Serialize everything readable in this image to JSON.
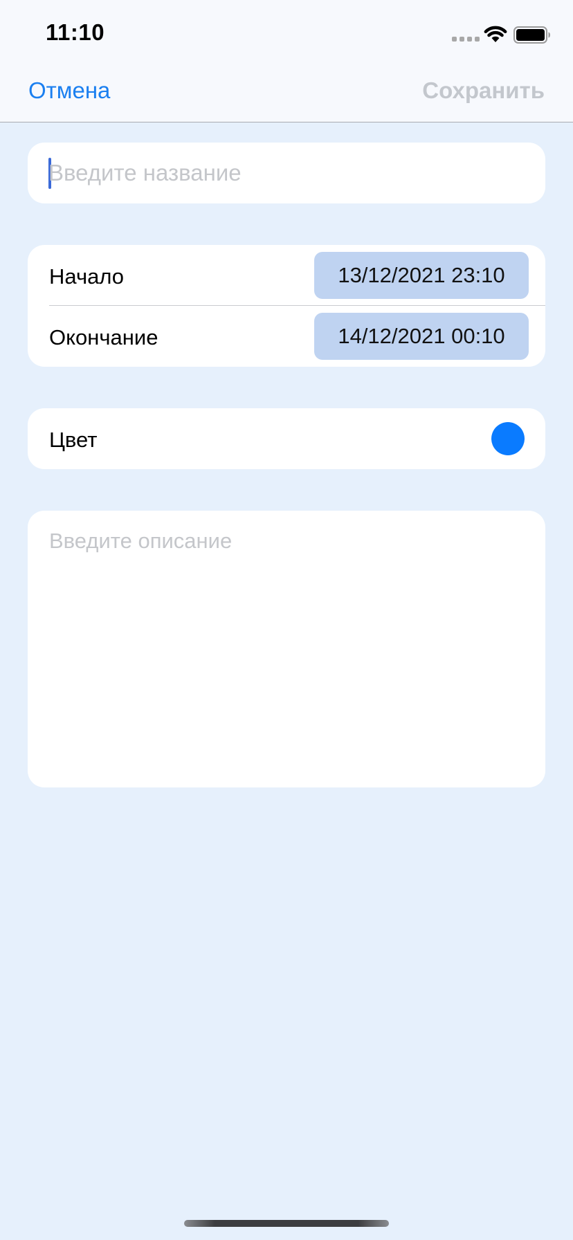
{
  "status_bar": {
    "time": "11:10",
    "icons": [
      "signal-icon",
      "wifi-icon",
      "battery-icon"
    ]
  },
  "nav": {
    "cancel_label": "Отмена",
    "save_label": "Сохранить"
  },
  "title_field": {
    "value": "",
    "placeholder": "Введите название"
  },
  "dates": {
    "start_label": "Начало",
    "start_value": "13/12/2021 23:10",
    "end_label": "Окончание",
    "end_value": "14/12/2021 00:10"
  },
  "color_row": {
    "label": "Цвет",
    "selected_color": "#0a7bff"
  },
  "description_field": {
    "value": "",
    "placeholder": "Введите описание"
  },
  "colors": {
    "accent": "#1a7ff0",
    "disabled": "#c3c7cd",
    "background": "#e6f0fc",
    "date_pill": "#bfd3f1"
  }
}
